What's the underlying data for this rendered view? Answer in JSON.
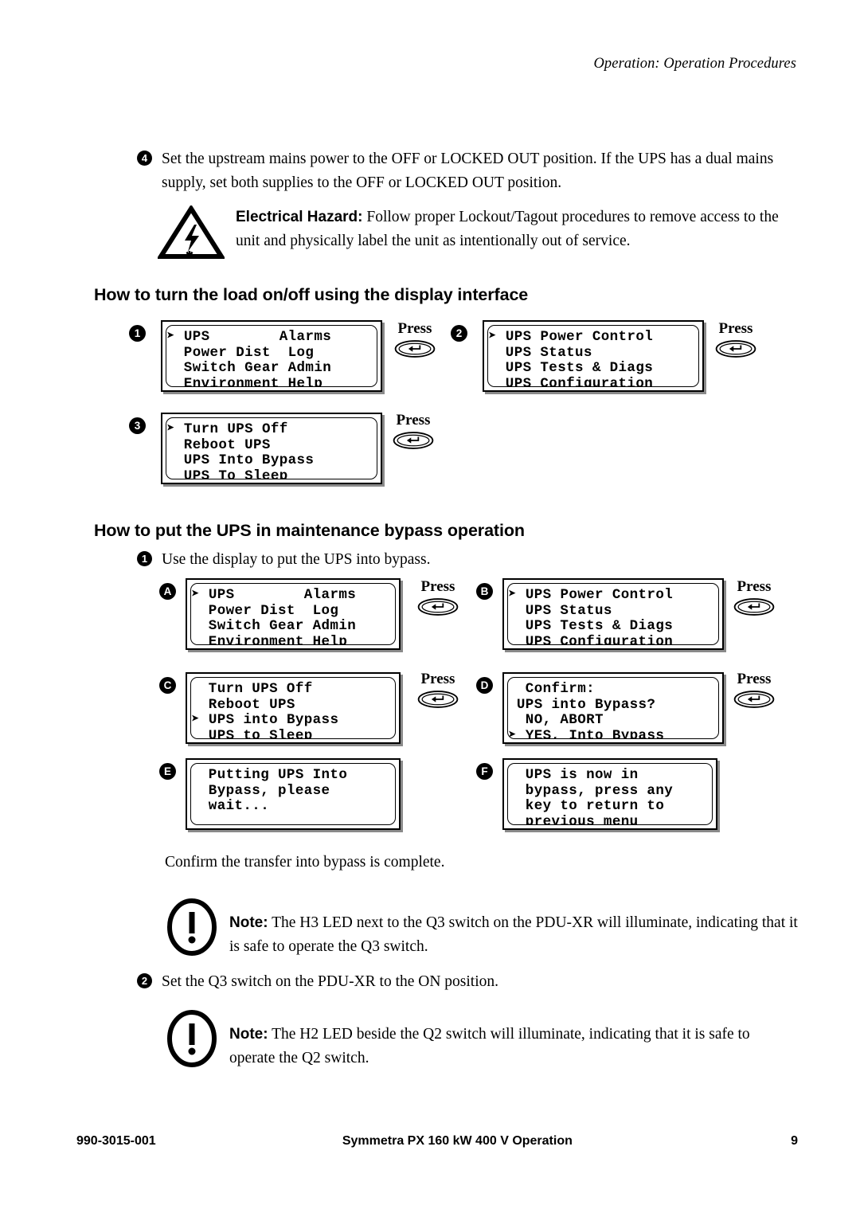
{
  "header": {
    "running_head": "Operation: Operation Procedures"
  },
  "steps": {
    "step4": {
      "number": "4",
      "text": "Set the upstream mains power to the OFF or LOCKED OUT position. If the UPS has a dual mains supply, set both supplies to the OFF or LOCKED OUT position."
    },
    "step_bypass_1": {
      "number": "1",
      "text": "Use the display to put the UPS into bypass."
    },
    "step_bypass_2": {
      "number": "2",
      "text": "Set the Q3 switch on the PDU-XR to the ON position."
    }
  },
  "hazard": {
    "icon": "electrical-hazard-triangle-icon",
    "lead": "Electrical Hazard:",
    "text": " Follow proper Lockout/Tagout procedures to remove access to the unit and physically label the unit as intentionally out of service."
  },
  "notes": [
    {
      "icon": "note-exclamation-icon",
      "lead": "Note:",
      "text": " The H3 LED next to the Q3 switch on the PDU-XR will illuminate, indicating that it is safe to operate the Q3 switch."
    },
    {
      "icon": "note-exclamation-icon",
      "lead": "Note:",
      "text": " The H2 LED beside the Q2 switch will illuminate, indicating that it is safe to operate the Q2 switch."
    }
  ],
  "sections": {
    "load_onoff": {
      "heading": "How to turn the load on/off using the display interface"
    },
    "maintenance_bypass": {
      "heading": "How to put the UPS in maintenance bypass operation",
      "confirm_text": "Confirm the transfer into bypass is complete."
    }
  },
  "press": {
    "label": "Press",
    "key_icon": "enter-key-icon"
  },
  "panels": {
    "p1": {
      "label": "1",
      "lines": [
        "➤ UPS        Alarms",
        "  Power Dist  Log",
        "  Switch Gear Admin",
        "  Environment Help"
      ]
    },
    "p2": {
      "label": "2",
      "lines": [
        "➤ UPS Power Control",
        "  UPS Status",
        "  UPS Tests & Diags",
        "  UPS Configuration"
      ]
    },
    "p3": {
      "label": "3",
      "lines": [
        "➤ Turn UPS Off",
        "  Reboot UPS",
        "  UPS Into Bypass",
        "  UPS To Sleep"
      ]
    },
    "pA": {
      "label": "A",
      "lines": [
        "➤ UPS        Alarms",
        "  Power Dist  Log",
        "  Switch Gear Admin",
        "  Environment Help"
      ]
    },
    "pB": {
      "label": "B",
      "lines": [
        "➤ UPS Power Control",
        "  UPS Status",
        "  UPS Tests & Diags",
        "  UPS Configuration"
      ]
    },
    "pC": {
      "label": "C",
      "lines": [
        "  Turn UPS Off",
        "  Reboot UPS",
        "➤ UPS into Bypass",
        "  UPS to Sleep"
      ]
    },
    "pD": {
      "label": "D",
      "lines": [
        "  Confirm:",
        " UPS into Bypass?",
        "  NO, ABORT",
        "➤ YES, Into Bypass"
      ]
    },
    "pE": {
      "label": "E",
      "lines": [
        "  Putting UPS Into",
        "  Bypass, please",
        "  wait..."
      ]
    },
    "pF": {
      "label": "F",
      "lines": [
        "  UPS is now in",
        "  bypass, press any",
        "  key to return to",
        "  previous menu"
      ]
    }
  },
  "footer": {
    "doc_number": "990-3015-001",
    "title": "Symmetra PX 160 kW 400 V Operation",
    "page": "9"
  }
}
